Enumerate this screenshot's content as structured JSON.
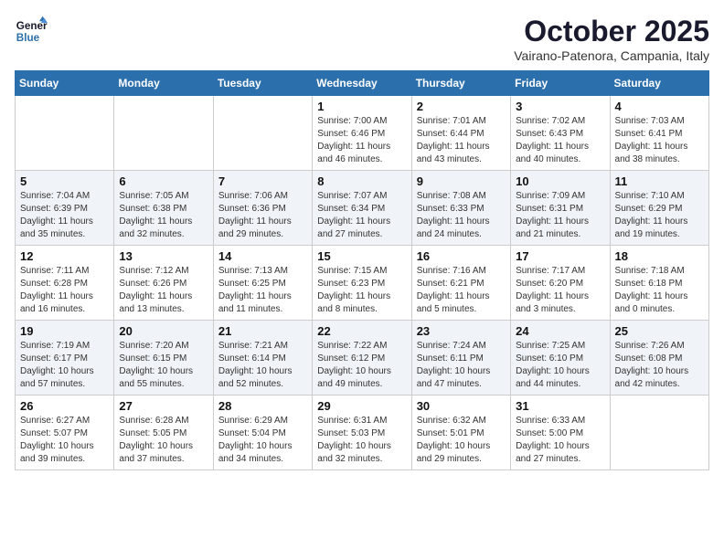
{
  "logo": {
    "line1": "General",
    "line2": "Blue"
  },
  "title": "October 2025",
  "subtitle": "Vairano-Patenora, Campania, Italy",
  "weekdays": [
    "Sunday",
    "Monday",
    "Tuesday",
    "Wednesday",
    "Thursday",
    "Friday",
    "Saturday"
  ],
  "weeks": [
    [
      {
        "day": "",
        "info": ""
      },
      {
        "day": "",
        "info": ""
      },
      {
        "day": "",
        "info": ""
      },
      {
        "day": "1",
        "info": "Sunrise: 7:00 AM\nSunset: 6:46 PM\nDaylight: 11 hours\nand 46 minutes."
      },
      {
        "day": "2",
        "info": "Sunrise: 7:01 AM\nSunset: 6:44 PM\nDaylight: 11 hours\nand 43 minutes."
      },
      {
        "day": "3",
        "info": "Sunrise: 7:02 AM\nSunset: 6:43 PM\nDaylight: 11 hours\nand 40 minutes."
      },
      {
        "day": "4",
        "info": "Sunrise: 7:03 AM\nSunset: 6:41 PM\nDaylight: 11 hours\nand 38 minutes."
      }
    ],
    [
      {
        "day": "5",
        "info": "Sunrise: 7:04 AM\nSunset: 6:39 PM\nDaylight: 11 hours\nand 35 minutes."
      },
      {
        "day": "6",
        "info": "Sunrise: 7:05 AM\nSunset: 6:38 PM\nDaylight: 11 hours\nand 32 minutes."
      },
      {
        "day": "7",
        "info": "Sunrise: 7:06 AM\nSunset: 6:36 PM\nDaylight: 11 hours\nand 29 minutes."
      },
      {
        "day": "8",
        "info": "Sunrise: 7:07 AM\nSunset: 6:34 PM\nDaylight: 11 hours\nand 27 minutes."
      },
      {
        "day": "9",
        "info": "Sunrise: 7:08 AM\nSunset: 6:33 PM\nDaylight: 11 hours\nand 24 minutes."
      },
      {
        "day": "10",
        "info": "Sunrise: 7:09 AM\nSunset: 6:31 PM\nDaylight: 11 hours\nand 21 minutes."
      },
      {
        "day": "11",
        "info": "Sunrise: 7:10 AM\nSunset: 6:29 PM\nDaylight: 11 hours\nand 19 minutes."
      }
    ],
    [
      {
        "day": "12",
        "info": "Sunrise: 7:11 AM\nSunset: 6:28 PM\nDaylight: 11 hours\nand 16 minutes."
      },
      {
        "day": "13",
        "info": "Sunrise: 7:12 AM\nSunset: 6:26 PM\nDaylight: 11 hours\nand 13 minutes."
      },
      {
        "day": "14",
        "info": "Sunrise: 7:13 AM\nSunset: 6:25 PM\nDaylight: 11 hours\nand 11 minutes."
      },
      {
        "day": "15",
        "info": "Sunrise: 7:15 AM\nSunset: 6:23 PM\nDaylight: 11 hours\nand 8 minutes."
      },
      {
        "day": "16",
        "info": "Sunrise: 7:16 AM\nSunset: 6:21 PM\nDaylight: 11 hours\nand 5 minutes."
      },
      {
        "day": "17",
        "info": "Sunrise: 7:17 AM\nSunset: 6:20 PM\nDaylight: 11 hours\nand 3 minutes."
      },
      {
        "day": "18",
        "info": "Sunrise: 7:18 AM\nSunset: 6:18 PM\nDaylight: 11 hours\nand 0 minutes."
      }
    ],
    [
      {
        "day": "19",
        "info": "Sunrise: 7:19 AM\nSunset: 6:17 PM\nDaylight: 10 hours\nand 57 minutes."
      },
      {
        "day": "20",
        "info": "Sunrise: 7:20 AM\nSunset: 6:15 PM\nDaylight: 10 hours\nand 55 minutes."
      },
      {
        "day": "21",
        "info": "Sunrise: 7:21 AM\nSunset: 6:14 PM\nDaylight: 10 hours\nand 52 minutes."
      },
      {
        "day": "22",
        "info": "Sunrise: 7:22 AM\nSunset: 6:12 PM\nDaylight: 10 hours\nand 49 minutes."
      },
      {
        "day": "23",
        "info": "Sunrise: 7:24 AM\nSunset: 6:11 PM\nDaylight: 10 hours\nand 47 minutes."
      },
      {
        "day": "24",
        "info": "Sunrise: 7:25 AM\nSunset: 6:10 PM\nDaylight: 10 hours\nand 44 minutes."
      },
      {
        "day": "25",
        "info": "Sunrise: 7:26 AM\nSunset: 6:08 PM\nDaylight: 10 hours\nand 42 minutes."
      }
    ],
    [
      {
        "day": "26",
        "info": "Sunrise: 6:27 AM\nSunset: 5:07 PM\nDaylight: 10 hours\nand 39 minutes."
      },
      {
        "day": "27",
        "info": "Sunrise: 6:28 AM\nSunset: 5:05 PM\nDaylight: 10 hours\nand 37 minutes."
      },
      {
        "day": "28",
        "info": "Sunrise: 6:29 AM\nSunset: 5:04 PM\nDaylight: 10 hours\nand 34 minutes."
      },
      {
        "day": "29",
        "info": "Sunrise: 6:31 AM\nSunset: 5:03 PM\nDaylight: 10 hours\nand 32 minutes."
      },
      {
        "day": "30",
        "info": "Sunrise: 6:32 AM\nSunset: 5:01 PM\nDaylight: 10 hours\nand 29 minutes."
      },
      {
        "day": "31",
        "info": "Sunrise: 6:33 AM\nSunset: 5:00 PM\nDaylight: 10 hours\nand 27 minutes."
      },
      {
        "day": "",
        "info": ""
      }
    ]
  ]
}
